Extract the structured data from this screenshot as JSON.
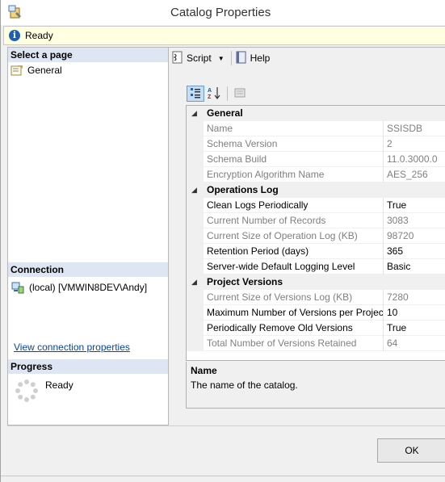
{
  "window": {
    "title": "Catalog Properties"
  },
  "status": {
    "icon": "info-icon",
    "text": "Ready"
  },
  "left": {
    "select_page_header": "Select a page",
    "pages": [
      {
        "label": "General",
        "icon": "properties-page-icon"
      }
    ],
    "connection_header": "Connection",
    "connection_value": "(local) [VMWIN8DEV\\Andy]",
    "view_connection_link": "View connection properties",
    "progress_header": "Progress",
    "progress_text": "Ready"
  },
  "toolbar": {
    "script_label": "Script",
    "help_label": "Help"
  },
  "grid": {
    "categories": [
      {
        "label": "General",
        "items": [
          {
            "name": "Name",
            "value": "SSISDB",
            "readonly": true
          },
          {
            "name": "Schema Version",
            "value": "2",
            "readonly": true
          },
          {
            "name": "Schema Build",
            "value": "11.0.3000.0",
            "readonly": true
          },
          {
            "name": "Encryption Algorithm Name",
            "value": "AES_256",
            "readonly": true
          }
        ]
      },
      {
        "label": "Operations Log",
        "items": [
          {
            "name": "Clean Logs Periodically",
            "value": "True",
            "readonly": false
          },
          {
            "name": "Current Number of Records",
            "value": "3083",
            "readonly": true
          },
          {
            "name": "Current Size of Operation Log (KB)",
            "value": "98720",
            "readonly": true
          },
          {
            "name": "Retention Period (days)",
            "value": "365",
            "readonly": false
          },
          {
            "name": "Server-wide Default Logging Level",
            "value": "Basic",
            "readonly": false
          }
        ]
      },
      {
        "label": "Project Versions",
        "items": [
          {
            "name": "Current Size of Versions Log (KB)",
            "value": "7280",
            "readonly": true
          },
          {
            "name": "Maximum Number of Versions per Project",
            "value": "10",
            "readonly": false
          },
          {
            "name": "Periodically Remove Old Versions",
            "value": "True",
            "readonly": false
          },
          {
            "name": "Total Number of Versions Retained",
            "value": "64",
            "readonly": true
          }
        ]
      }
    ]
  },
  "description": {
    "title": "Name",
    "text": "The name of the catalog."
  },
  "buttons": {
    "ok_label": "OK"
  }
}
